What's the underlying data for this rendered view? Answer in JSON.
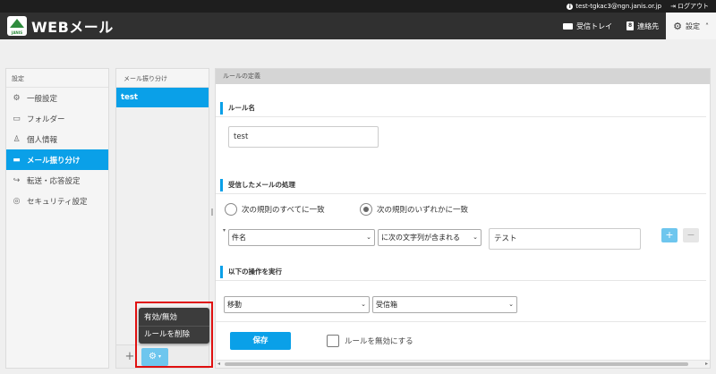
{
  "topbar": {
    "account": "test-tgkac3@ngn.janis.or.jp",
    "logout": "ログアウト"
  },
  "header": {
    "logo_badge": "JANIS",
    "title": "WEBメール",
    "nav": {
      "inbox": "受信トレイ",
      "contacts": "連絡先",
      "settings": "設定"
    }
  },
  "leftnav": {
    "heading": "設定",
    "items": [
      {
        "label": "一般設定",
        "icon": "gear-icon"
      },
      {
        "label": "フォルダー",
        "icon": "folder-icon"
      },
      {
        "label": "個人情報",
        "icon": "person-icon"
      },
      {
        "label": "メール振り分け",
        "icon": "folder-filled-icon"
      },
      {
        "label": "転送・応答設定",
        "icon": "forward-icon"
      },
      {
        "label": "セキュリティ設定",
        "icon": "security-icon"
      }
    ]
  },
  "rulelist": {
    "heading": "メール振り分け",
    "items": [
      "test"
    ]
  },
  "popup": {
    "enable_disable": "有効/無効",
    "delete_rule": "ルールを削除"
  },
  "main": {
    "title": "ルールの定義",
    "rule_name": {
      "label": "ルール名",
      "value": "test"
    },
    "incoming": {
      "label": "受信したメールの処理",
      "match_all": "次の規則のすべてに一致",
      "match_any": "次の規則のいずれかに一致",
      "field_select": "件名",
      "operator_select": "に次の文字列が含まれる",
      "value": "テスト",
      "add": "+",
      "remove": "−"
    },
    "actions": {
      "label": "以下の操作を実行",
      "action_select": "移動",
      "folder_select": "受信箱"
    },
    "save": "保存",
    "disable_rule": "ルールを無効にする"
  },
  "colors": {
    "accent": "#0aa0e8",
    "header_bg": "#303030",
    "highlight": "#e01010"
  }
}
